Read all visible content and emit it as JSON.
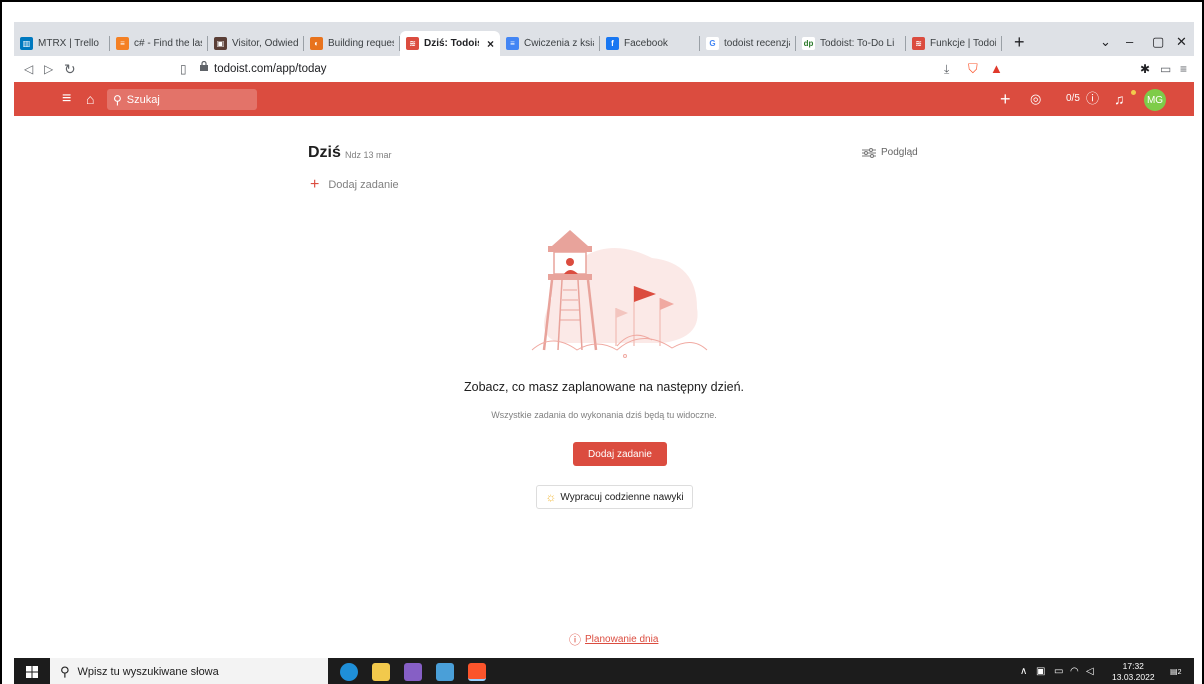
{
  "browser": {
    "tabs": [
      {
        "label": "MTRX | Trello",
        "icon": "trello-icon",
        "color": "#0079bf",
        "glyph": "▥"
      },
      {
        "label": "c# - Find the last",
        "icon": "stackoverflow-icon",
        "color": "#f48024",
        "glyph": "≡"
      },
      {
        "label": "Visitor, Odwiedza",
        "icon": "site-icon",
        "color": "#5a3e36",
        "glyph": "▣"
      },
      {
        "label": "Building request",
        "icon": "refactoring-icon",
        "color": "#e8731d",
        "glyph": "◐"
      },
      {
        "label": "Dziś: Todoist",
        "icon": "todoist-icon",
        "color": "#db4c3f",
        "glyph": "≋",
        "active": true
      },
      {
        "label": "Ćwiczenia z ksiaz",
        "icon": "docs-icon",
        "color": "#4285f4",
        "glyph": "≡"
      },
      {
        "label": "Facebook",
        "icon": "facebook-icon",
        "color": "#1877f2",
        "glyph": "f"
      },
      {
        "label": "todoist recenzja",
        "icon": "google-icon",
        "color": "#ffffff",
        "glyph": "G"
      },
      {
        "label": "Todoist: To-Do Li",
        "icon": "dp-icon",
        "color": "#ffffff",
        "glyph": "dp"
      },
      {
        "label": "Funkcje | Todoist",
        "icon": "todoist-icon",
        "color": "#db4c3f",
        "glyph": "≋"
      }
    ],
    "new_tab": "+",
    "url": "todoist.com/app/today"
  },
  "app": {
    "search_placeholder": "Szukaj",
    "karma": "0/5",
    "avatar_initials": "MG",
    "page_title": "Dziś",
    "page_date": "Ndz 13 mar",
    "view_label": "Podgląd",
    "add_task": "Dodaj zadanie",
    "empty_heading": "Zobacz, co masz zaplanowane na następny dzień.",
    "empty_sub": "Wszystkie zadania do wykonania dziś będą tu widoczne.",
    "primary_button": "Dodaj zadanie",
    "habits_button": "Wypracuj codzienne nawyki",
    "plan_link": "Planowanie dnia"
  },
  "taskbar": {
    "search_placeholder": "Wpisz tu wyszukiwane słowa",
    "time": "17:32",
    "date": "13.03.2022",
    "notifications": "2"
  },
  "colors": {
    "brand": "#db4c3f",
    "avatar": "#7ecc49"
  }
}
